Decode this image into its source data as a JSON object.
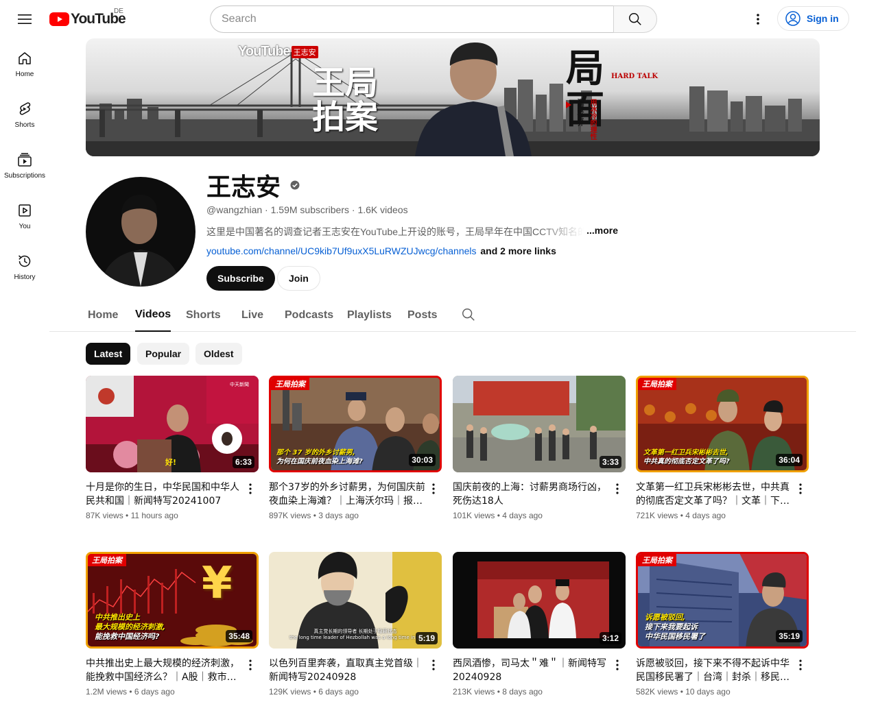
{
  "header": {
    "logo_text": "YouTube",
    "region": "DE",
    "search_placeholder": "Search",
    "sign_in": "Sign in"
  },
  "guide": {
    "items": [
      {
        "label": "Home",
        "icon": "home-icon"
      },
      {
        "label": "Shorts",
        "icon": "shorts-icon"
      },
      {
        "label": "Subscriptions",
        "icon": "subscriptions-icon"
      },
      {
        "label": "You",
        "icon": "you-icon"
      },
      {
        "label": "History",
        "icon": "history-icon"
      }
    ]
  },
  "banner": {
    "youtube_tag": "YouTube",
    "tag_name": "王志安",
    "left_title": "王局拍案",
    "right_title": "局面",
    "hard_talk": "HARD TALK",
    "slogan_1": "用冰冷的理性",
    "slogan_2": "温暖世界"
  },
  "channel": {
    "name": "王志安",
    "handle": "@wangzhian",
    "subscribers": "1.59M subscribers",
    "videos": "1.6K videos",
    "description": "这里是中国著名的调查记者王志安在YouTube上开设的账号，王局早年在中国CCTV知名的",
    "more": "...more",
    "link": "youtube.com/channel/UC9kib7Uf9uxX5LuRWZUJwcg/channels",
    "more_links": "and 2 more links",
    "subscribe": "Subscribe",
    "join": "Join"
  },
  "tabs": [
    "Home",
    "Videos",
    "Shorts",
    "Live",
    "Podcasts",
    "Playlists",
    "Posts"
  ],
  "active_tab": "Videos",
  "chips": [
    "Latest",
    "Popular",
    "Oldest"
  ],
  "active_chip": "Latest",
  "videos": [
    {
      "title": "十月是你的生日，中华民国和中华人民共和国｜新闻特写20241007",
      "views": "87K views",
      "age": "11 hours ago",
      "duration": "6:33",
      "overlay": "好!",
      "corner": "中天新聞"
    },
    {
      "title": "那个37岁的外乡讨薪男，为何国庆前夜血染上海滩？｜上海沃尔玛｜报…",
      "views": "897K views",
      "age": "3 days ago",
      "duration": "30:03",
      "badge": "王局拍案",
      "caption_1": "那个 37 岁的外乡讨薪男,",
      "caption_2": "为何在国庆前夜血染上海滩?"
    },
    {
      "title": "国庆前夜的上海：讨薪男商场行凶，死伤达18人",
      "views": "101K views",
      "age": "4 days ago",
      "duration": "3:33"
    },
    {
      "title": "文革第一红卫兵宋彬彬去世，中共真的彻底否定文革了吗？｜文革｜下…",
      "views": "721K views",
      "age": "4 days ago",
      "duration": "36:04",
      "badge": "王局拍案",
      "caption_1": "文革第一红卫兵宋彬彬去世,",
      "caption_2": "中共真的彻底否定文革了吗?"
    },
    {
      "title": "中共推出史上最大规模的经济刺激，能挽救中国经济么？｜A股｜救市…",
      "views": "1.2M views",
      "age": "6 days ago",
      "duration": "35:48",
      "badge": "王局拍案",
      "caption_1": "中共推出史上",
      "caption_2": "最大规模的经济刺激,",
      "caption_3": "能挽救中国经济吗?",
      "symbol": "¥"
    },
    {
      "title": "以色列百里奔袭，直取真主党首级｜新闻特写20240928",
      "views": "129K views",
      "age": "6 days ago",
      "duration": "5:19",
      "subtitle_cn": "真主党长期的领导者 长期处于隐蔽状态",
      "subtitle_en": "the long time leader of Hezbollah was a long time in hi"
    },
    {
      "title": "西凤酒惨，司马太＂难＂｜新闻特写20240928",
      "views": "213K views",
      "age": "8 days ago",
      "duration": "3:12"
    },
    {
      "title": "诉愿被驳回，接下来不得不起诉中华民国移民署了｜台湾｜封杀｜移民…",
      "views": "582K views",
      "age": "10 days ago",
      "duration": "35:19",
      "badge": "王局拍案",
      "caption_1": "诉愿被驳回,",
      "caption_2": "接下来我要起诉",
      "caption_3": "中华民国移民署了"
    }
  ],
  "colors": {
    "accent_red": "#ff0000",
    "link_blue": "#065fd4",
    "caption_yellow": "#ffe600",
    "badge_red": "#e00000"
  }
}
